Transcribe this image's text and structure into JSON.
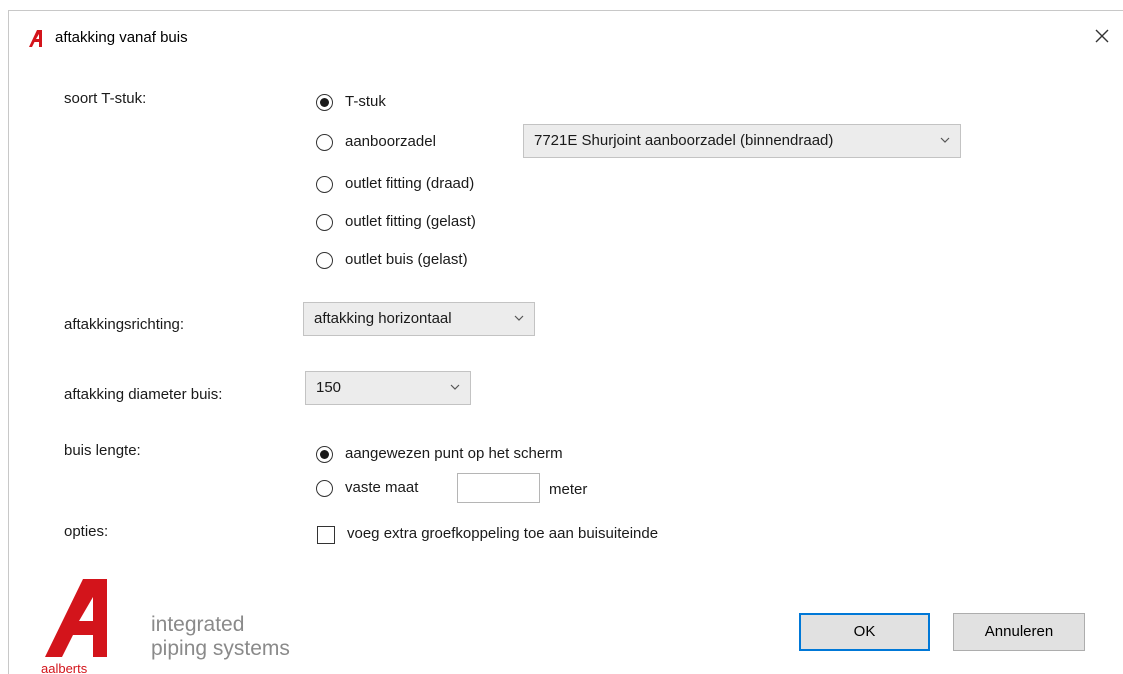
{
  "dialog": {
    "title": "aftakking vanaf buis",
    "close_glyph": "✕"
  },
  "soort_tstuk": {
    "label": "soort T-stuk:",
    "options": [
      {
        "label": "T-stuk",
        "checked": true
      },
      {
        "label": "aanboorzadel",
        "checked": false
      },
      {
        "label": "outlet fitting (draad)",
        "checked": false
      },
      {
        "label": "outlet fitting (gelast)",
        "checked": false
      },
      {
        "label": "outlet buis (gelast)",
        "checked": false
      }
    ],
    "zadel_select": "7721E Shurjoint aanboorzadel (binnendraad)"
  },
  "richting": {
    "label": "aftakkingsrichting:",
    "value": "aftakking horizontaal"
  },
  "diameter": {
    "label": "aftakking diameter buis:",
    "value": "150"
  },
  "lengte": {
    "label": "buis lengte:",
    "option_point": "aangewezen punt op het scherm",
    "option_fixed": "vaste maat",
    "fixed_value": "",
    "unit": "meter",
    "selected": "aangewezen punt op het scherm"
  },
  "opties": {
    "label": "opties:",
    "extra_coupling": "voeg extra groefkoppeling toe aan buisuiteinde",
    "extra_coupling_checked": false
  },
  "buttons": {
    "ok": "OK",
    "cancel": "Annuleren"
  },
  "logo": {
    "tagline_1": "integrated",
    "tagline_2": "piping systems",
    "brand": "aalberts"
  },
  "colors": {
    "brand_red": "#d3141b",
    "focus_blue": "#0078d7"
  },
  "icons": {
    "combo_arrow": "chevron-down-icon",
    "close": "close-icon",
    "app": "aalberts-logo-icon"
  }
}
